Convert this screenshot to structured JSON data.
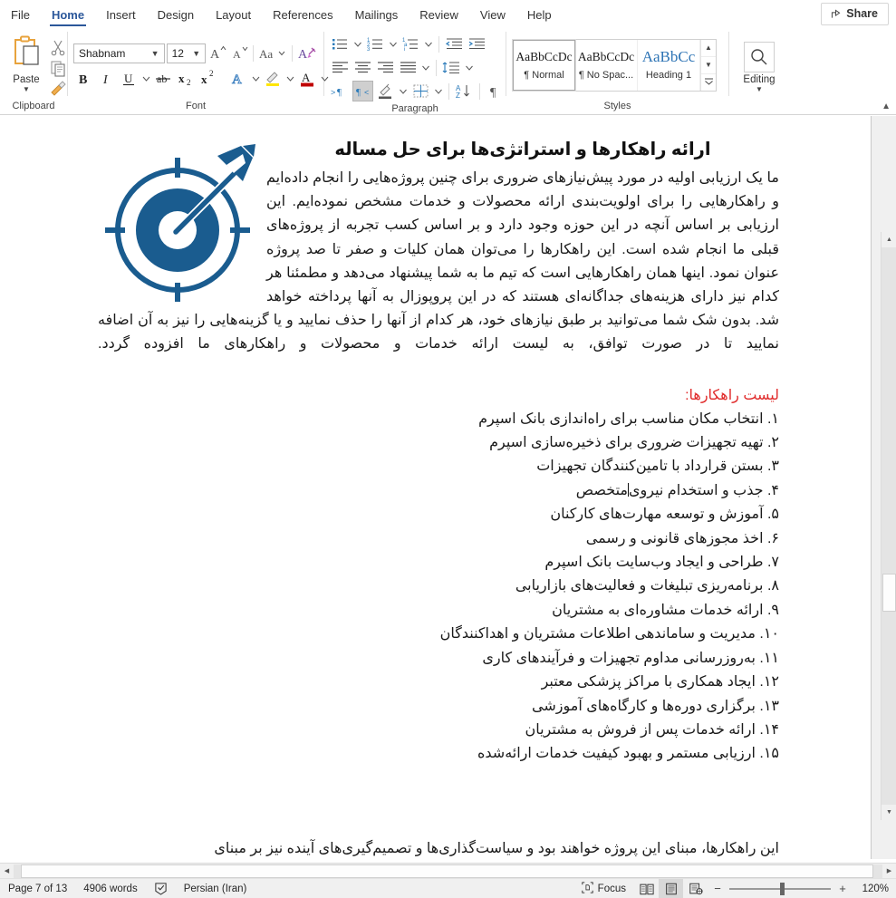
{
  "window": {
    "app": "Microsoft Word"
  },
  "ribbon": {
    "tabs": [
      {
        "label": "File",
        "name": "tab-file"
      },
      {
        "label": "Home",
        "name": "tab-home",
        "active": true
      },
      {
        "label": "Insert",
        "name": "tab-insert"
      },
      {
        "label": "Design",
        "name": "tab-design"
      },
      {
        "label": "Layout",
        "name": "tab-layout"
      },
      {
        "label": "References",
        "name": "tab-references"
      },
      {
        "label": "Mailings",
        "name": "tab-mailings"
      },
      {
        "label": "Review",
        "name": "tab-review"
      },
      {
        "label": "View",
        "name": "tab-view"
      },
      {
        "label": "Help",
        "name": "tab-help"
      }
    ],
    "share_label": "Share",
    "groups": {
      "clipboard": {
        "label": "Clipboard",
        "paste_label": "Paste"
      },
      "font": {
        "label": "Font",
        "font_name": "Shabnam",
        "font_size": "12"
      },
      "paragraph": {
        "label": "Paragraph"
      },
      "styles": {
        "label": "Styles",
        "tiles": [
          {
            "preview": "AaBbCcDc",
            "name": "¶ Normal",
            "selected": true
          },
          {
            "preview": "AaBbCcDc",
            "name": "¶ No Spac...",
            "selected": false
          },
          {
            "preview": "AaBbCс",
            "name": "Heading 1",
            "selected": false,
            "heading": true
          }
        ]
      },
      "editing": {
        "label": "Editing"
      }
    }
  },
  "document": {
    "heading": "ارائه راهکارها و استراتژی‌ها برای حل مساله",
    "paragraph1": "ما یک ارزیابی اولیه در مورد پیش‌نیازهای ضروری برای چنین پروژه‌هایی را انجام داده‌ایم و راهکارهایی را برای اولویت‌بندی ارائه محصولات و خدمات مشخص نموده‌ایم. این ارزیابی بر اساس آنچه در این حوزه وجود دارد و بر اساس کسب تجربه از پروژه‌های قبلی ما انجام شده است. این راهکارها را می‌توان همان کلیات و صفر تا صد پروژه عنوان نمود. اینها همان راهکارهایی است که تیم ما به شما پیشنهاد می‌دهد و مطمئنا هر کدام نیز دارای هزینه‌های جداگانه‌ای هستند که در این پروپوزال به آنها پرداخته خواهد شد. بدون شک شما می‌توانید بر طبق نیازهای خود، هر کدام از آنها را حذف نمایید و یا گزینه‌هایی را نیز به آن اضافه نمایید تا در صورت توافق، به لیست ارائه خدمات و محصولات و راهکارهای ما افزوده گردد.",
    "list_heading": "لیست راهکارها:",
    "list_items": [
      "۱. انتخاب مکان مناسب برای راه‌اندازی بانک اسپرم",
      "۲. تهیه تجهیزات ضروری برای ذخیره‌سازی اسپرم",
      "۳. بستن قرارداد با تامین‌کنندگان تجهیزات",
      "۴. جذب و استخدام نیروی متخصص",
      "۵. آموزش و توسعه مهارت‌های کارکنان",
      "۶. اخذ مجوزهای قانونی و رسمی",
      "۷. طراحی و ایجاد وب‌سایت بانک اسپرم",
      "۸. برنامه‌ریزی تبلیغات و فعالیت‌های بازاریابی",
      "۹. ارائه خدمات مشاوره‌ای به مشتریان",
      "۱۰. مدیریت و ساماندهی اطلاعات مشتریان و اهداکنندگان",
      "۱۱. به‌روزرسانی مداوم تجهیزات و فرآیندهای کاری",
      "۱۲. ایجاد همکاری با مراکز پزشکی معتبر",
      "۱۳. برگزاری دوره‌ها و کارگاه‌های آموزشی",
      "۱۴. ارائه خدمات پس از فروش به مشتریان",
      "۱۵. ارزیابی مستمر و بهبود کیفیت خدمات ارائه‌شده"
    ],
    "paragraph2": "این راهکارها، مبنای این پروژه خواهند بود و سیاست‌گذاری‌ها و تصمیم‌گیری‌های آینده نیز بر مبنای",
    "cursor_item_index": 3,
    "list_heading_color": "#e02b2b",
    "image_color": "#1a5c8f",
    "image_alt": "target-with-arrow"
  },
  "status": {
    "page": "Page 7 of 13",
    "words": "4906 words",
    "language": "Persian (Iran)",
    "focus_label": "Focus",
    "zoom_label": "120%"
  }
}
